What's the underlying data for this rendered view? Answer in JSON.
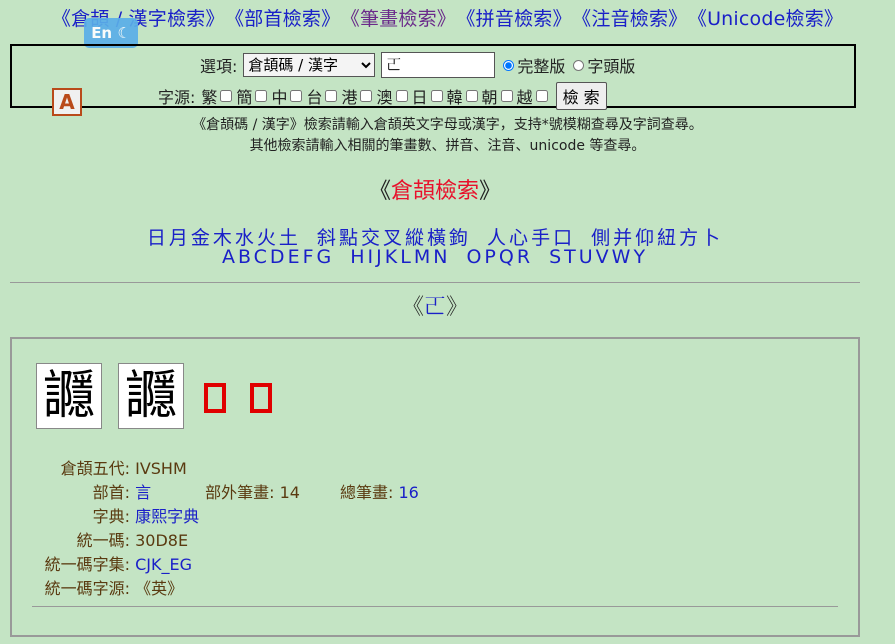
{
  "nav": {
    "items": [
      {
        "label": "《倉頡 / 漢字檢索》"
      },
      {
        "label": "《部首檢索》"
      },
      {
        "label": "《筆畫檢索》"
      },
      {
        "label": "《拼音檢索》"
      },
      {
        "label": "《注音檢索》"
      },
      {
        "label": "《Unicode檢索》"
      }
    ]
  },
  "lang_badge": {
    "label": "En ☾"
  },
  "search": {
    "option_label": "選項:",
    "mode_selected": "倉頡碼 / 漢字",
    "query_value": "𠀀",
    "radio_full": "完整版",
    "radio_head": "字頭版",
    "source_label": "字源:",
    "sources": [
      "繁",
      "簡",
      "中",
      "台",
      "港",
      "澳",
      "日",
      "韓",
      "朝",
      "越"
    ],
    "submit_label": "檢 索"
  },
  "logo": {
    "letter": "A"
  },
  "help": {
    "line1": "《倉頡碼 / 漢字》檢索請輸入倉頡英文字母或漢字，支持*號模糊查尋及字詞查尋。",
    "line2": "其他檢索請輸入相關的筆畫數、拼音、注音、unicode 等查尋。"
  },
  "cangjie_section": {
    "open": "《",
    "title": "倉頡檢索",
    "close": "》",
    "radicals": [
      "日",
      "月",
      "金",
      "木",
      "水",
      "火",
      "土",
      "斜",
      "點",
      "交",
      "叉",
      "縱",
      "橫",
      "鉤",
      "人",
      "心",
      "手",
      "口",
      "側",
      "并",
      "仰",
      "紐",
      "方",
      "卜"
    ],
    "letters": [
      "A",
      "B",
      "C",
      "D",
      "E",
      "F",
      "G",
      "H",
      "I",
      "J",
      "K",
      "L",
      "M",
      "N",
      "O",
      "P",
      "Q",
      "R",
      "S",
      "T",
      "U",
      "V",
      "W",
      "Y"
    ]
  },
  "result_section": {
    "open": "《",
    "title": "𠀀",
    "close": "》"
  },
  "result": {
    "glyph1": "讔",
    "glyph2": "讔",
    "cangjie_label": "倉頡五代:",
    "cangjie_value": "IVSHM",
    "radical_label": "部首:",
    "radical_value": "言",
    "extra_strokes_label": "部外筆畫:",
    "extra_strokes_value": "14",
    "total_strokes_label": "總筆畫:",
    "total_strokes_value": "16",
    "dict_label": "字典:",
    "dict_value": "康熙字典",
    "unicode_label": "統一碼:",
    "unicode_value": "30D8E",
    "block_label": "統一碼字集:",
    "block_value": "CJK_EG",
    "source_label": "統一碼字源:",
    "source_value": "《英》"
  }
}
